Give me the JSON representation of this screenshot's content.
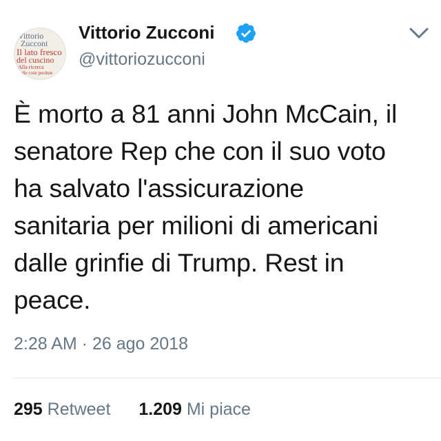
{
  "tweet": {
    "author": {
      "name": "Vittorio Zucconi",
      "handle": "@vittoriozucconi",
      "avatar_text": [
        "Vittorio",
        "Zucconi",
        "Il lato fresco",
        "del cuscino",
        "Alla ricerca",
        "delle cose perdute"
      ]
    },
    "text": "È morto a 81 anni John McCain, il\nsenatore Rep che con il suo voto\nha salvato l'assicurazione\nsanitaria per milioni di americani\ndalle grinfie di Trump. Rest in\npeace.",
    "timestamp": "2:28 AM · 26 ago 2018",
    "stats": {
      "retweets_count": "295",
      "retweets_label": "Retweet",
      "likes_count": "1.209",
      "likes_label": "Mi piace"
    }
  },
  "icons": {
    "verified": "verified-badge-icon",
    "menu": "chevron-down-icon"
  },
  "colors": {
    "verified_blue": "#1da1f2",
    "text_primary": "#14171a",
    "text_secondary": "#657786",
    "divider": "#e1e8ed"
  }
}
